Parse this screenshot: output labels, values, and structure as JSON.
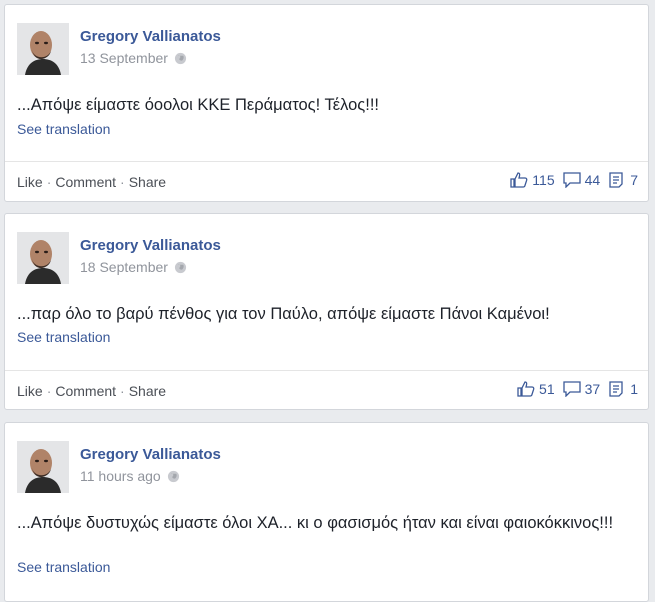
{
  "posts": [
    {
      "author": "Gregory Vallianatos",
      "time": "13 September",
      "text": "...Απόψε είμαστε όοολοι ΚΚΕ Περάματος! Τέλος!!!",
      "see_translation": "See translation",
      "actions": {
        "like": "Like",
        "comment": "Comment",
        "share": "Share",
        "separator": "·"
      },
      "counts": {
        "likes": "115",
        "comments": "44",
        "shares": "7"
      }
    },
    {
      "author": "Gregory Vallianatos",
      "time": "18 September",
      "text": "...παρ όλο το βαρύ πένθος για τον Παύλο, απόψε είμαστε Πάνοι Καμένοι!",
      "see_translation": "See translation",
      "actions": {
        "like": "Like",
        "comment": "Comment",
        "share": "Share",
        "separator": "·"
      },
      "counts": {
        "likes": "51",
        "comments": "37",
        "shares": "1"
      }
    },
    {
      "author": "Gregory Vallianatos",
      "time": "11 hours ago",
      "text": "...Απόψε δυστυχώς είμαστε όλοι ΧΑ... κι ο φασισμός ήταν και είναι φαιοκόκκινος!!!",
      "see_translation": "See translation"
    }
  ],
  "icons": {
    "privacy": "globe-icon",
    "like": "thumbs-up-icon",
    "comment": "comment-bubble-icon",
    "share": "share-icon"
  },
  "colors": {
    "link": "#3b5998",
    "background": "#e9ebee",
    "meta": "#90949c"
  }
}
